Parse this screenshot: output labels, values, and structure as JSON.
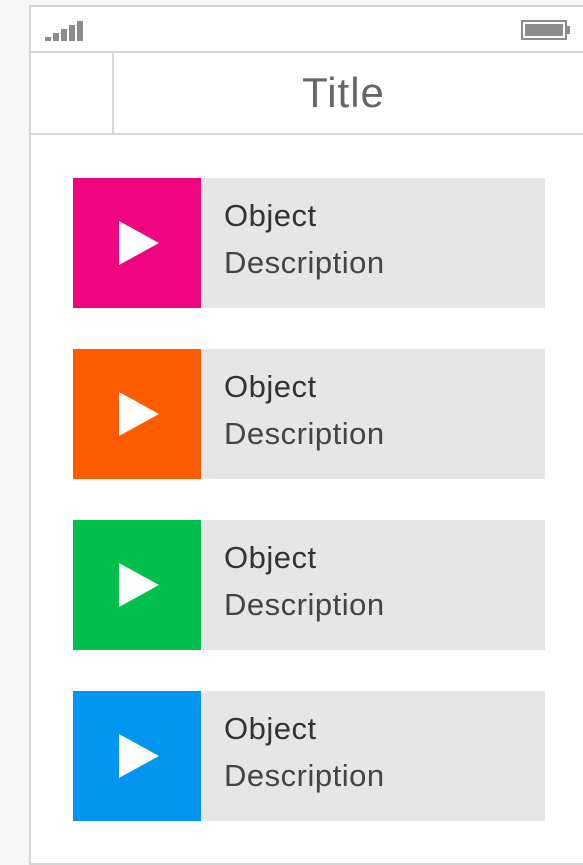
{
  "header": {
    "title": "Title",
    "status_icons": {
      "signal": "signal-strength-icon",
      "battery": "battery-icon"
    }
  },
  "list": {
    "items": [
      {
        "title": "Object",
        "description": "Description",
        "thumb_color": "#f0047f",
        "icon": "play-icon"
      },
      {
        "title": "Object",
        "description": "Description",
        "thumb_color": "#ff5b00",
        "icon": "play-icon"
      },
      {
        "title": "Object",
        "description": "Description",
        "thumb_color": "#00c04b",
        "icon": "play-icon"
      },
      {
        "title": "Object",
        "description": "Description",
        "thumb_color": "#0096f0",
        "icon": "play-icon"
      }
    ]
  },
  "colors": {
    "panel_bg": "#e6e6e6",
    "divider": "#d6d6d6",
    "title_text": "#666666",
    "body_text": "#333333"
  }
}
